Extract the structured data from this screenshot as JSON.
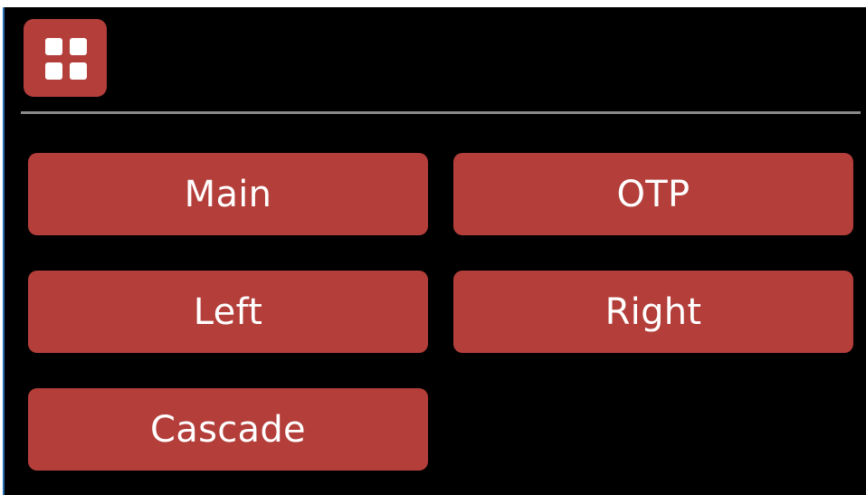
{
  "toolbar": {
    "menu_icon": "grid-icon"
  },
  "buttons": {
    "main": "Main",
    "otp": "OTP",
    "left": "Left",
    "right": "Right",
    "cascade": "Cascade"
  },
  "colors": {
    "background": "#000000",
    "button": "#b33e3a",
    "button_text": "#ffffff",
    "divider": "#8a8a8a",
    "accent_edge": "#2b6fb3"
  }
}
